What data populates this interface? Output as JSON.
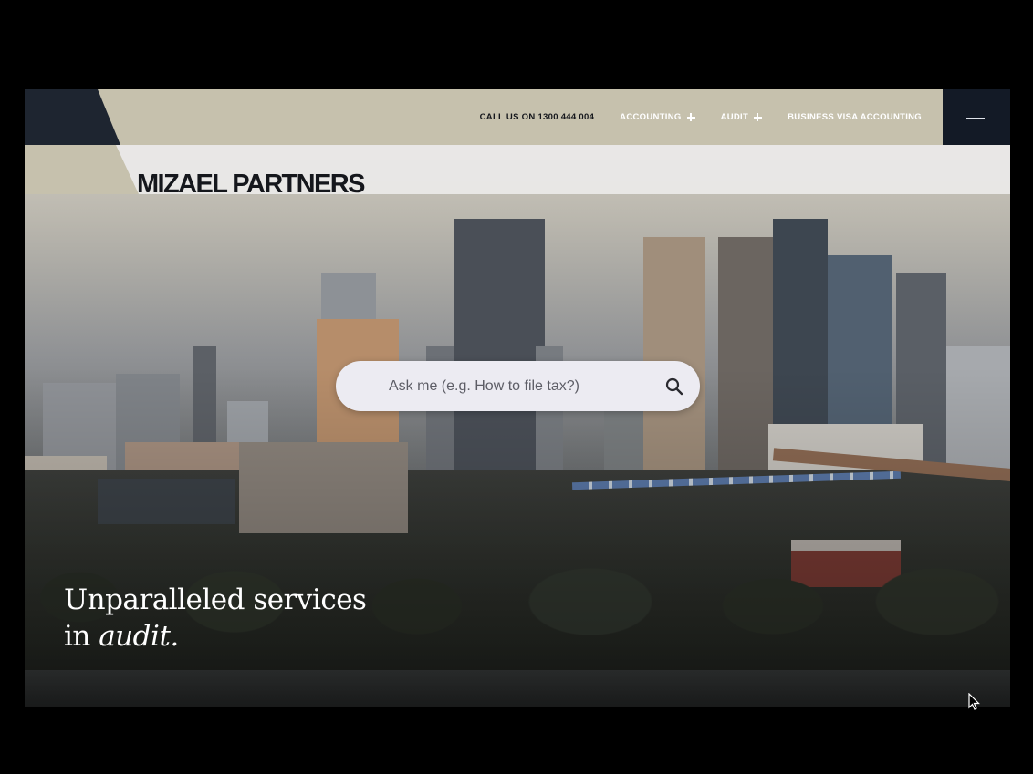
{
  "header": {
    "logo": "MIZAEL PARTNERS",
    "nav": [
      {
        "label": "CALL US ON 1300 444 004",
        "has_plus": false
      },
      {
        "label": "ACCOUNTING",
        "has_plus": true
      },
      {
        "label": "AUDIT",
        "has_plus": true
      },
      {
        "label": "BUSINESS VISA ACCOUNTING",
        "has_plus": false
      }
    ],
    "menu_icon": "plus-icon"
  },
  "search": {
    "placeholder": "Ask me (e.g. How to file tax?)",
    "value": "",
    "icon": "search-icon"
  },
  "hero": {
    "tagline_line1": "Unparalleled services",
    "tagline_prefix": "in ",
    "tagline_emphasis": "audit."
  },
  "colors": {
    "topbar": "#c6c1ad",
    "dark_accent": "#131a26",
    "logo_bar": "#eae9e8",
    "search_bg": "#ecebf2"
  }
}
